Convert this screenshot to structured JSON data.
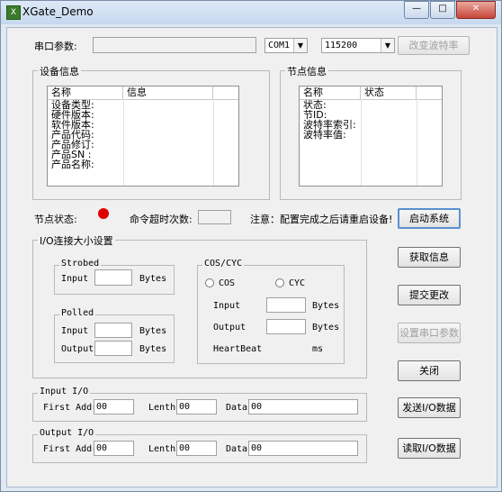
{
  "window": {
    "title": "XGate_Demo",
    "minimize": "—",
    "maximize": "□",
    "close": "✕"
  },
  "serial": {
    "label": "串口参数:",
    "params_value": "",
    "port": "COM1",
    "baud": "115200",
    "change_baud_button": "改变波特率"
  },
  "device_info": {
    "group": "设备信息",
    "col_name": "名称",
    "col_info": "信息",
    "rows": [
      "设备类型:",
      "硬件版本:",
      "软件版本:",
      "产品代码:",
      "产品修订:",
      "产品SN   :",
      "产品名称:"
    ]
  },
  "node_info": {
    "group": "节点信息",
    "col_name": "名称",
    "col_status": "状态",
    "rows": [
      "状态:",
      "节ID:",
      "波特率索引:",
      "波特率值:"
    ]
  },
  "status_row": {
    "node_status_label": "节点状态:",
    "led_color": "#e00000",
    "timeout_label": "命令超时次数:",
    "timeout_value": "",
    "notice": "注意：配置完成之后请重启设备!"
  },
  "io_size": {
    "group": "I/O连接大小设置",
    "strobed": {
      "label": "Strobed",
      "input_label": "Input",
      "input_value": "",
      "unit": "Bytes"
    },
    "polled": {
      "label": "Polled",
      "input_label": "Input",
      "input_value": "",
      "output_label": "Output",
      "output_value": "",
      "unit": "Bytes"
    },
    "cos_cyc": {
      "label": "COS/CYC",
      "cos": "COS",
      "cyc": "CYC",
      "input_label": "Input",
      "input_value": "",
      "output_label": "Output",
      "output_value": "",
      "unit": "Bytes",
      "heartbeat_label": "HeartBeat",
      "heartbeat_unit": "ms"
    }
  },
  "input_io": {
    "group": "Input I/O",
    "first_addr_label": "First Addr",
    "first_addr": "00",
    "length_label": "Lenth",
    "length": "00",
    "data_label": "Data",
    "data": "00"
  },
  "output_io": {
    "group": "Output I/O",
    "first_addr_label": "First Addr",
    "first_addr": "00",
    "length_label": "Lenth",
    "length": "00",
    "data_label": "Data",
    "data": "00"
  },
  "buttons": {
    "start": "启动系统",
    "get_info": "获取信息",
    "submit": "提交更改",
    "set_serial": "设置串口参数",
    "close": "关闭",
    "send_io": "发送I/O数据",
    "read_io": "读取I/O数据"
  }
}
